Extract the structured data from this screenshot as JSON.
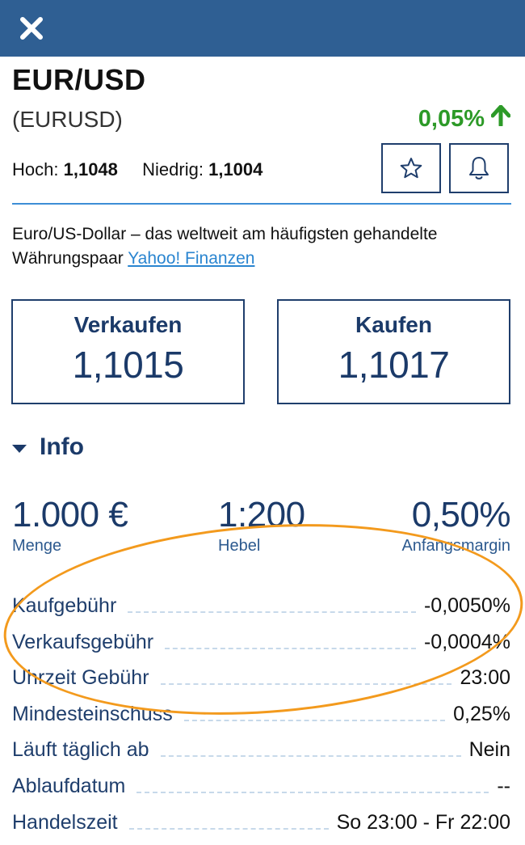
{
  "header": {
    "close_icon": "close-icon"
  },
  "instrument": {
    "name": "EUR/USD",
    "symbol": "(EURUSD)",
    "change": "0,05%",
    "change_color": "#2d9a28",
    "change_icon": "arrow-up-icon",
    "high_label": "Hoch:",
    "high_value": "1,1048",
    "low_label": "Niedrig:",
    "low_value": "1,1004",
    "description": "Euro/US-Dollar – das weltweit am häufigsten gehandelte Währungspaar",
    "source_link": "Yahoo! Finanzen"
  },
  "actions": {
    "favorite_icon": "star-icon",
    "alert_icon": "bell-icon"
  },
  "trade": {
    "sell_label": "Verkaufen",
    "sell_price": "1,1015",
    "buy_label": "Kaufen",
    "buy_price": "1,1017"
  },
  "info": {
    "toggle_label": "Info",
    "stats": [
      {
        "value": "1.000 €",
        "label": "Menge"
      },
      {
        "value": "1:200",
        "label": "Hebel"
      },
      {
        "value": "0,50%",
        "label": "Anfangsmargin"
      }
    ],
    "rows": [
      {
        "label": "Kaufgebühr",
        "value": "-0,0050%"
      },
      {
        "label": "Verkaufsgebühr",
        "value": "-0,0004%"
      },
      {
        "label": "Uhrzeit Gebühr",
        "value": "23:00"
      },
      {
        "label": "Mindesteinschuss",
        "value": "0,25%"
      },
      {
        "label": "Läuft täglich ab",
        "value": "Nein"
      },
      {
        "label": "Ablaufdatum",
        "value": "--"
      },
      {
        "label": "Handelszeit",
        "value": "So 23:00 - Fr 22:00"
      }
    ]
  },
  "colors": {
    "navy": "#1b3a69",
    "header_bg": "#2f5f93",
    "accent_blue": "#3d8ed6",
    "highlight_orange": "#f39a1d"
  }
}
